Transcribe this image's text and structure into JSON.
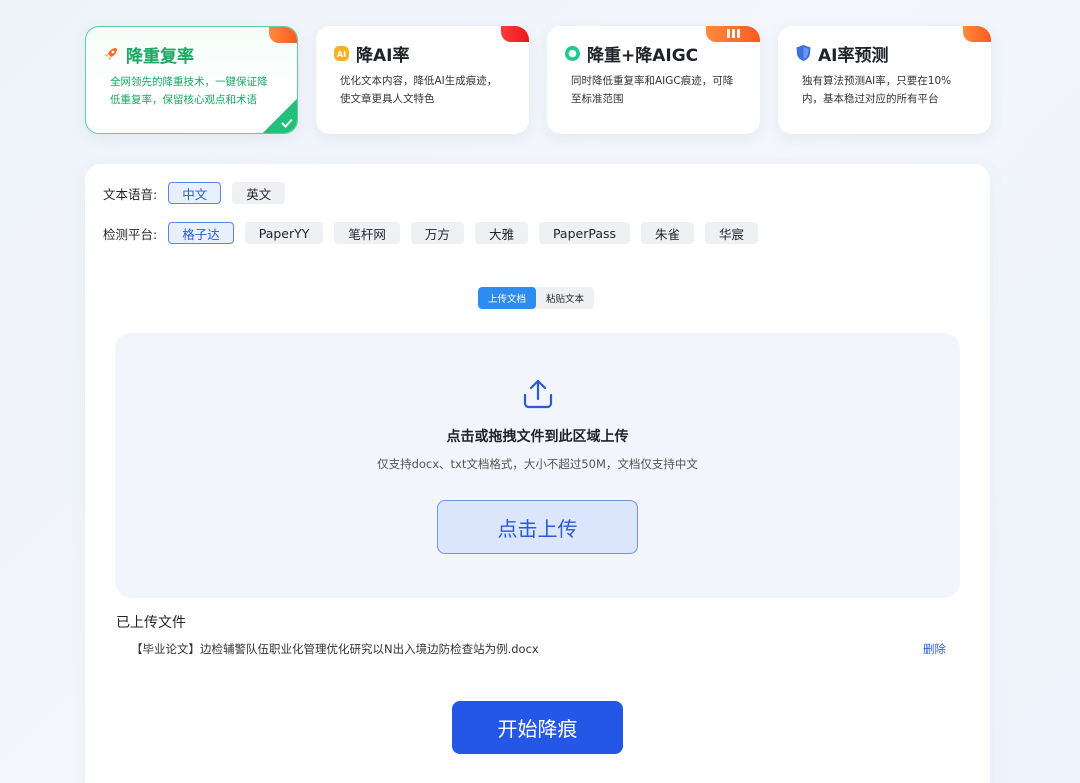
{
  "features": [
    {
      "title": "降重复率",
      "desc_lines": [
        "全网领先的降重技术，一键保证降",
        "低重复率，保留核心观点和术语"
      ],
      "icon": "rocket-icon",
      "badge": "new"
    },
    {
      "title": "降AI率",
      "desc_lines": [
        "优化文本内容，降低AI生成痕迹，",
        "使文章更具人文特色"
      ],
      "icon": "ai-icon",
      "badge": "hot"
    },
    {
      "title": "降重+降AIGC",
      "desc_lines": [
        "同时降低重复率和AIGC痕迹，可降",
        "至标准范围"
      ],
      "icon": "ring-icon",
      "badge": "recommend"
    },
    {
      "title": "AI率预测",
      "desc_lines": [
        "独有算法预测AI率，只要在10%",
        "内，基本稳过对应的所有平台"
      ],
      "icon": "shield-icon",
      "badge": "free"
    }
  ],
  "language": {
    "label": "文本语音:",
    "options": [
      "中文",
      "英文"
    ],
    "selected": "中文"
  },
  "platform": {
    "label": "检测平台:",
    "options": [
      "格子达",
      "PaperYY",
      "笔杆网",
      "万方",
      "大雅",
      "PaperPass",
      "朱雀",
      "华宸"
    ],
    "selected": "格子达"
  },
  "input_mode": {
    "options": [
      "上传文档",
      "粘贴文本"
    ],
    "selected": "上传文档"
  },
  "upload": {
    "title": "点击或拖拽文件到此区域上传",
    "subtitle": "仅支持docx、txt文档格式，大小不超过50M，文档仅支持中文",
    "button": "点击上传"
  },
  "uploaded": {
    "title": "已上传文件",
    "file_name": "【毕业论文】边检辅警队伍职业化管理优化研究以N出入境边防检查站为例.docx",
    "delete_label": "删除"
  },
  "start_button": "开始降痕",
  "colors": {
    "primary": "#2557e6",
    "success": "#22c07a",
    "badge_orange": "#ff6a28",
    "badge_red": "#e81818"
  }
}
